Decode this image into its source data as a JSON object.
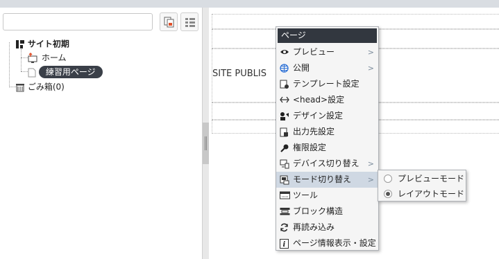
{
  "tree": {
    "root_label": "サイト初期",
    "items": [
      {
        "label": "ホーム"
      },
      {
        "label": "練習用ページ"
      },
      {
        "label": "ごみ箱(0)"
      }
    ]
  },
  "canvas": {
    "site_text": "SITE PUBLIS"
  },
  "context_menu": {
    "title": "ページ",
    "items": [
      {
        "label": "プレビュー",
        "icon": "eye-icon",
        "arrow": ">"
      },
      {
        "label": "公開",
        "icon": "globe-icon",
        "arrow": ">"
      },
      {
        "label": "テンプレート設定",
        "icon": "template-settings-icon"
      },
      {
        "label": "<head>設定",
        "icon": "code-arrows-icon"
      },
      {
        "label": "デザイン設定",
        "icon": "design-icon"
      },
      {
        "label": "出力先設定",
        "icon": "output-icon"
      },
      {
        "label": "権限設定",
        "icon": "key-icon"
      },
      {
        "label": "デバイス切り替え",
        "icon": "device-switch-icon",
        "arrow": ">"
      },
      {
        "label": "モード切り替え",
        "icon": "mode-switch-icon",
        "arrow": ">"
      },
      {
        "label": "ツール",
        "icon": "tool-icon"
      },
      {
        "label": "ブロック構造",
        "icon": "block-structure-icon"
      },
      {
        "label": "再読み込み",
        "icon": "reload-icon"
      },
      {
        "label": "ページ情報表示・設定",
        "icon": "info-icon"
      }
    ]
  },
  "mode_submenu": {
    "items": [
      {
        "label": "プレビューモード",
        "checked": false
      },
      {
        "label": "レイアウトモード",
        "checked": true
      }
    ]
  },
  "colors": {
    "menu_header_bg": "#32373f",
    "menu_highlight_bg": "#cfd8e3",
    "selected_pill_bg": "#3a3f48",
    "home_icon_accent": "#e0502a",
    "globe_icon": "#2a6fd6"
  }
}
